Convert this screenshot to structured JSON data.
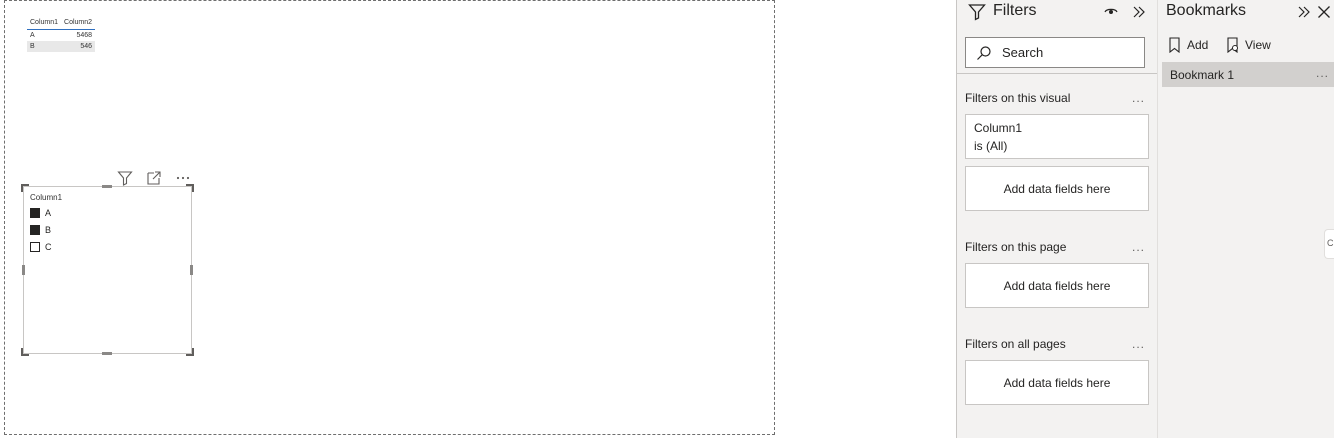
{
  "table_visual": {
    "columns": [
      "Column1",
      "Column2"
    ],
    "rows": [
      {
        "c1": "A",
        "c2": "5468"
      },
      {
        "c1": "B",
        "c2": "546"
      }
    ]
  },
  "slicer": {
    "title": "Column1",
    "items": [
      {
        "label": "A",
        "checked": true
      },
      {
        "label": "B",
        "checked": true
      },
      {
        "label": "C",
        "checked": false
      }
    ],
    "header_icons": [
      "filter-icon",
      "focus-mode-icon",
      "more-options-icon"
    ]
  },
  "filters_pane": {
    "title": "Filters",
    "search_placeholder": "Search",
    "sections": [
      {
        "label": "Filters on this visual",
        "more": "..."
      },
      {
        "label": "Filters on this page",
        "more": "..."
      },
      {
        "label": "Filters on all pages",
        "more": "..."
      }
    ],
    "filter_card": {
      "field": "Column1",
      "condition": "is (All)"
    },
    "drop_label": "Add data fields here"
  },
  "bookmarks_pane": {
    "title": "Bookmarks",
    "add_label": "Add",
    "view_label": "View",
    "items": [
      {
        "label": "Bookmark 1",
        "more": "..."
      }
    ],
    "edge_tab_label": "C"
  },
  "colors": {
    "pane_bg": "#f3f2f1",
    "selected_bookmark": "#d2d0ce",
    "table_header_rule": "#2f6fbf"
  }
}
